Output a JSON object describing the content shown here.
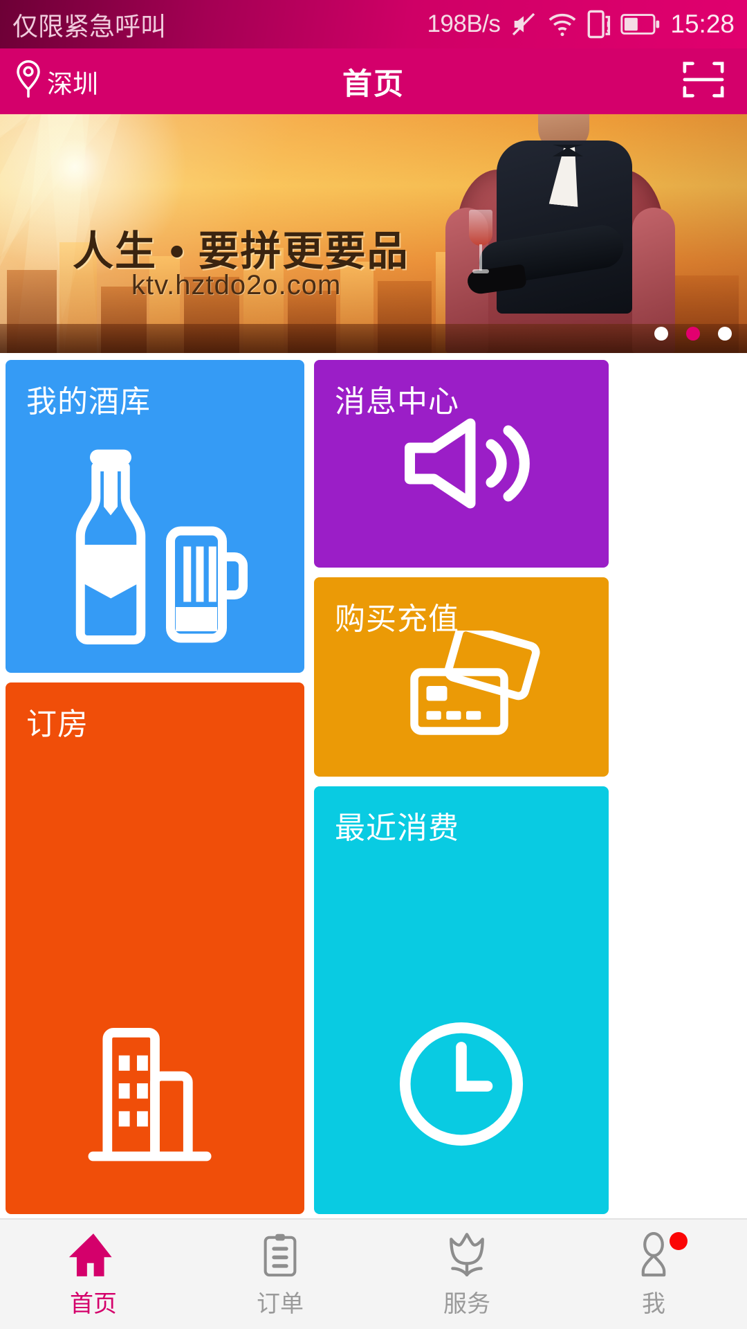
{
  "status_bar": {
    "carrier_text": "仅限紧急呼叫",
    "net_speed": "198B/s",
    "time": "15:28",
    "icons": [
      "mute-icon",
      "wifi-icon",
      "sim-card-icon",
      "battery-icon"
    ],
    "battery_level_pct": 45
  },
  "header": {
    "location_icon": "location-pin-icon",
    "location": "深圳",
    "title": "首页",
    "scan_icon": "scan-frame-icon",
    "background_color": "#d4006b"
  },
  "banner": {
    "slogan": "人生 • 要拼更要品",
    "url": "ktv.hztdo2o.com",
    "carousel": {
      "count": 3,
      "active_index": 1
    }
  },
  "tiles": [
    {
      "id": "my-wine-cellar",
      "label": "我的酒库",
      "color": "#359bf5",
      "icon": "beer-bottle-and-mug-icon"
    },
    {
      "id": "message-center",
      "label": "消息中心",
      "color": "#9b1ec7",
      "icon": "speaker-volume-icon"
    },
    {
      "id": "purchase-recharge",
      "label": "购买充值",
      "color": "#eb9a06",
      "icon": "credit-cards-icon"
    },
    {
      "id": "book-room",
      "label": "订房",
      "color": "#f04e09",
      "icon": "building-icon"
    },
    {
      "id": "recent-consumption",
      "label": "最近消费",
      "color": "#09cbe2",
      "icon": "clock-icon"
    }
  ],
  "bottom_nav": {
    "active_color": "#d4006b",
    "inactive_color": "#9a9a9a",
    "items": [
      {
        "label": "首页",
        "icon": "home-icon",
        "active": true,
        "badge": false
      },
      {
        "label": "订单",
        "icon": "clipboard-icon",
        "active": false,
        "badge": false
      },
      {
        "label": "服务",
        "icon": "tulip-icon",
        "active": false,
        "badge": false
      },
      {
        "label": "我",
        "icon": "person-icon",
        "active": false,
        "badge": true
      }
    ]
  }
}
